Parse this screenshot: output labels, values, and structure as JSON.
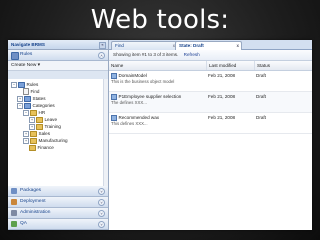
{
  "slide": {
    "title": "Web tools:"
  },
  "left": {
    "header": "Navigate BRMS",
    "rules_section": "Rules",
    "create_new": "Create New",
    "create_arrow": "▾",
    "tree": [
      {
        "label": "Rules",
        "expander": "−",
        "icon": "pkg",
        "indent": 0
      },
      {
        "label": "Find",
        "expander": "",
        "icon": "file",
        "indent": 1
      },
      {
        "label": "States",
        "expander": "+",
        "icon": "pkg",
        "indent": 1
      },
      {
        "label": "Categories",
        "expander": "−",
        "icon": "pkg",
        "indent": 1
      },
      {
        "label": "HR",
        "expander": "−",
        "icon": "folder",
        "indent": 2
      },
      {
        "label": "Leave",
        "expander": "+",
        "icon": "folder",
        "indent": 3
      },
      {
        "label": "Training",
        "expander": "+",
        "icon": "folder",
        "indent": 3
      },
      {
        "label": "Sales",
        "expander": "+",
        "icon": "folder",
        "indent": 2
      },
      {
        "label": "Manufacturing",
        "expander": "+",
        "icon": "folder",
        "indent": 2
      },
      {
        "label": "Finance",
        "expander": "",
        "icon": "folder",
        "indent": 2
      }
    ],
    "bottom_sections": [
      {
        "label": "Packages",
        "color": "#6f8fc4"
      },
      {
        "label": "Deployment",
        "color": "#c9863a"
      },
      {
        "label": "Administration",
        "color": "#7e8aa3"
      },
      {
        "label": "QA",
        "color": "#5ea04d"
      }
    ]
  },
  "right": {
    "tabs": [
      {
        "label": "Find",
        "close": "x",
        "active": false
      },
      {
        "label": "State: Draft",
        "close": "x",
        "active": true
      }
    ],
    "toolbar": {
      "summary": "Showing item #1 to 3 of 3 items.",
      "refresh": "Refresh"
    },
    "columns": [
      "Name",
      "Last modified",
      "Status"
    ],
    "rows": [
      {
        "name": "DomainModel",
        "desc": "This is the business object model",
        "modified": "Feb 21, 2008",
        "status": "Draft"
      },
      {
        "name": "P1Employee supplier selection",
        "desc": "The defines XXX...",
        "modified": "Feb 21, 2008",
        "status": "Draft"
      },
      {
        "name": "Recommended wax",
        "desc": "This defines XXX...",
        "modified": "Feb 21, 2008",
        "status": "Draft"
      }
    ]
  }
}
